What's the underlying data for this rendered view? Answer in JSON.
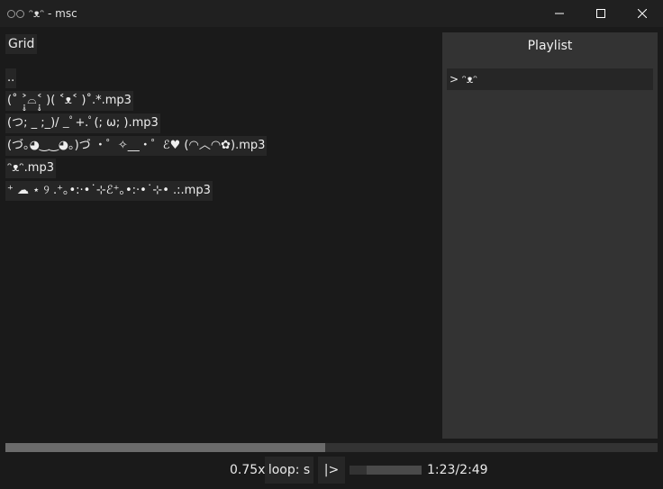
{
  "window": {
    "title": "ᵔᴥᵔ - msc"
  },
  "browser": {
    "grid_label": "Grid",
    "entries": [
      {
        "label": ".."
      },
      {
        "label": "(˚ ˃̣̣̥⌓˂̣̣̥ )( ˂ᴥ˂ )˚.*.mp3"
      },
      {
        "label": "(つ; _ ;_)/ _ﾟ+.ﾟ(; ω; ).mp3"
      },
      {
        "label": "(づ｡◕‿‿◕｡)づ ・゜✧__・゜ℰ♥ (◠︿◠✿).mp3"
      },
      {
        "label": "ᵔᴥᵔ.mp3"
      },
      {
        "label": "⁺ ☁ ⋆ ୨ .⁺｡•:·•˙⊹ℰ⁺｡•:·•˙⊹• .:.mp3"
      }
    ]
  },
  "playlist": {
    "header": "Playlist",
    "items": [
      {
        "label": "> ᵔᴥᵔ"
      }
    ]
  },
  "player": {
    "progress_fraction": 0.49,
    "speed_label": "0.75x",
    "loop_label": "loop: s",
    "play_label": "|>",
    "volume_fraction": 0.24,
    "time_label": "1:23/2:49"
  },
  "colors": {
    "background": "#1a1a1a",
    "panel": "#333333",
    "button": "#262626",
    "seek_fill": "#6b6b6b"
  },
  "icons": {
    "app": "app-icon",
    "minimize": "minimize-icon",
    "maximize": "maximize-icon",
    "close": "close-icon"
  }
}
